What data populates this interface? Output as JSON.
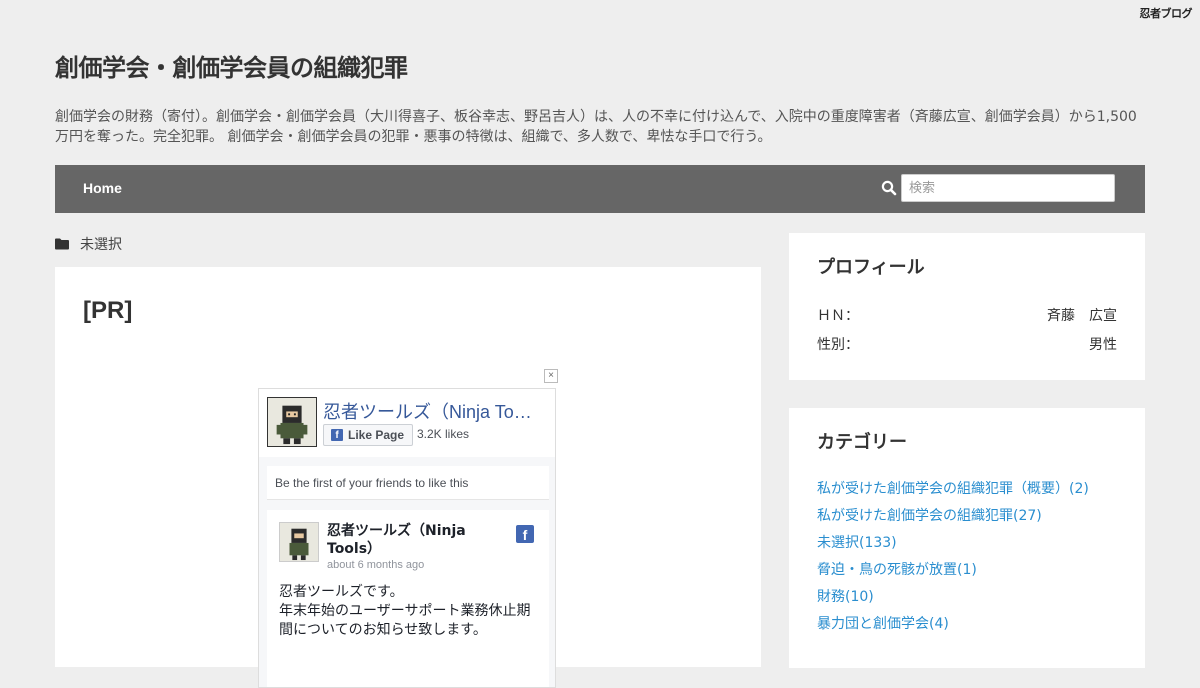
{
  "brand": {
    "logo_text": "忍者ブログ"
  },
  "site": {
    "title": "創価学会・創価学会員の組織犯罪",
    "description": "創価学会の財務（寄付）。創価学会・創価学会員（大川得喜子、板谷幸志、野呂吉人）は、人の不幸に付け込んで、入院中の重度障害者（斉藤広宣、創価学会員）から1,500万円を奪った。完全犯罪。 創価学会・創価学会員の犯罪・悪事の特徴は、組織で、多人数で、卑怯な手口で行う。"
  },
  "nav": {
    "home": "Home",
    "search_placeholder": "検索"
  },
  "breadcrumb": {
    "category": "未選択"
  },
  "post": {
    "title": "[PR]"
  },
  "fb_widget": {
    "close": "×",
    "page_name": "忍者ツールズ（Ninja Tools）",
    "like_button": "Like Page",
    "like_icon": "f",
    "likes": "3.2K likes",
    "friends_text": "Be the first of your friends to like this",
    "post": {
      "author": "忍者ツールズ（Ninja Tools）",
      "time": "about 6 months ago",
      "text": "忍者ツールズです。\n年末年始のユーザーサポート業務休止期間についてのお知らせ致します。"
    }
  },
  "profile": {
    "title": "プロフィール",
    "rows": [
      {
        "label": "ＨＮ：",
        "value": "斉藤　広宣"
      },
      {
        "label": "性別：",
        "value": "男性"
      }
    ]
  },
  "categories": {
    "title": "カテゴリー",
    "items": [
      "私が受けた創価学会の組織犯罪（概要）(2)",
      "私が受けた創価学会の組織犯罪(27)",
      "未選択(133)",
      "脅迫・鳥の死骸が放置(1)",
      "財務(10)",
      "暴力団と創価学会(4)"
    ]
  },
  "icons": {
    "search": "search-icon",
    "folder": "folder-icon",
    "facebook": "facebook-icon"
  },
  "colors": {
    "nav_bg": "#666666",
    "link": "#2a8ecf",
    "fb_blue": "#4267b2"
  }
}
